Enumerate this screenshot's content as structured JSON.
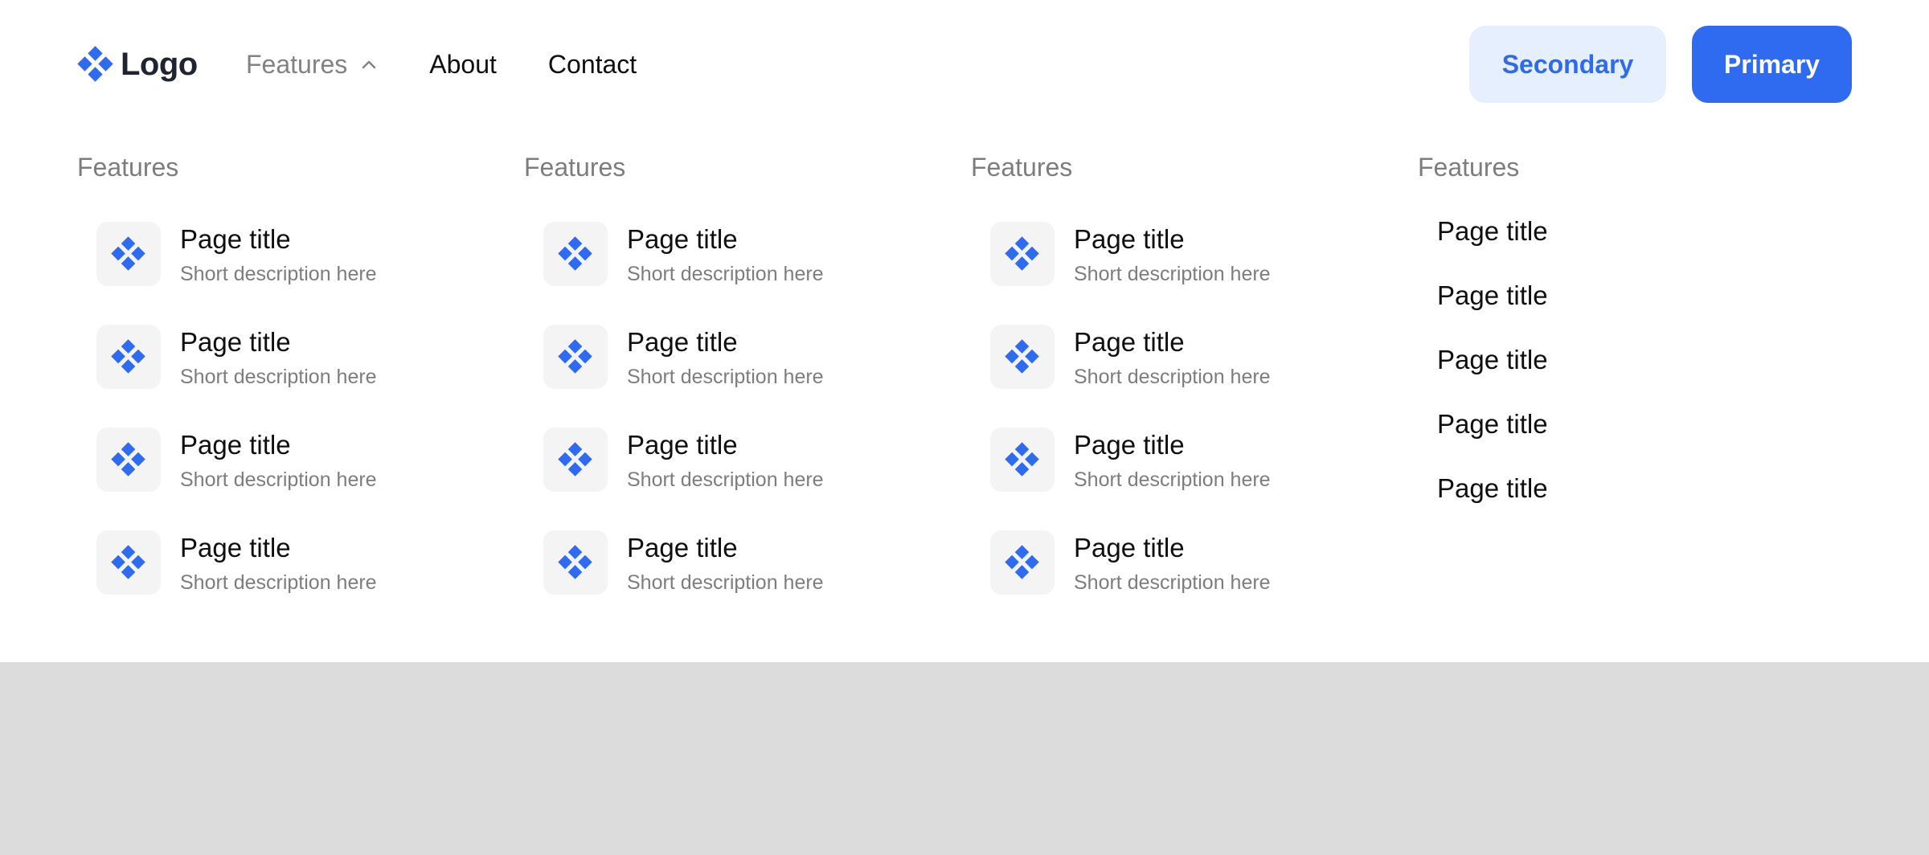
{
  "brand": {
    "logo_text": "Logo",
    "logo_icon": "diamond-cluster-icon",
    "accent": "#2f6bf0"
  },
  "nav": {
    "links": [
      {
        "label": "Features",
        "active": true,
        "icon": "chevron-up-icon"
      },
      {
        "label": "About"
      },
      {
        "label": "Contact"
      }
    ],
    "secondary_label": "Secondary",
    "primary_label": "Primary"
  },
  "menu": {
    "columns": [
      {
        "heading": "Features",
        "items": [
          {
            "title": "Page title",
            "description": "Short description here",
            "icon": "diamond-cluster-icon"
          },
          {
            "title": "Page title",
            "description": "Short description here",
            "icon": "diamond-cluster-icon"
          },
          {
            "title": "Page title",
            "description": "Short description here",
            "icon": "diamond-cluster-icon"
          },
          {
            "title": "Page title",
            "description": "Short description here",
            "icon": "diamond-cluster-icon"
          }
        ]
      },
      {
        "heading": "Features",
        "items": [
          {
            "title": "Page title",
            "description": "Short description here",
            "icon": "diamond-cluster-icon"
          },
          {
            "title": "Page title",
            "description": "Short description here",
            "icon": "diamond-cluster-icon"
          },
          {
            "title": "Page title",
            "description": "Short description here",
            "icon": "diamond-cluster-icon"
          },
          {
            "title": "Page title",
            "description": "Short description here",
            "icon": "diamond-cluster-icon"
          }
        ]
      },
      {
        "heading": "Features",
        "items": [
          {
            "title": "Page title",
            "description": "Short description here",
            "icon": "diamond-cluster-icon"
          },
          {
            "title": "Page title",
            "description": "Short description here",
            "icon": "diamond-cluster-icon"
          },
          {
            "title": "Page title",
            "description": "Short description here",
            "icon": "diamond-cluster-icon"
          },
          {
            "title": "Page title",
            "description": "Short description here",
            "icon": "diamond-cluster-icon"
          }
        ]
      },
      {
        "heading": "Features",
        "links": [
          {
            "title": "Page title"
          },
          {
            "title": "Page title"
          },
          {
            "title": "Page title"
          },
          {
            "title": "Page title"
          },
          {
            "title": "Page title"
          }
        ]
      }
    ]
  }
}
